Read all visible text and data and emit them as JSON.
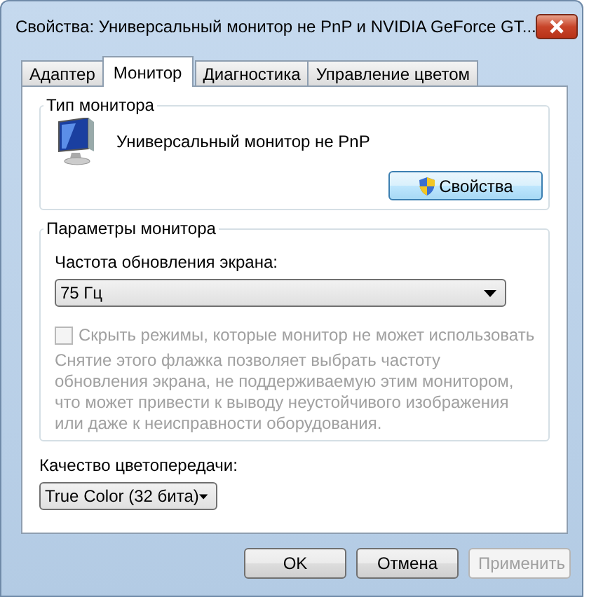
{
  "window": {
    "title": "Свойства: Универсальный монитор не PnP и NVIDIA GeForce GT..."
  },
  "tabs": [
    {
      "label": "Адаптер",
      "selected": false
    },
    {
      "label": "Монитор",
      "selected": true
    },
    {
      "label": "Диагностика",
      "selected": false
    },
    {
      "label": "Управление цветом",
      "selected": false
    }
  ],
  "monitor_type": {
    "title": "Тип монитора",
    "name": "Универсальный монитор не PnP",
    "button": "Свойства"
  },
  "monitor_settings": {
    "title": "Параметры монитора",
    "refresh_label": "Частота обновления экрана:",
    "refresh_value": "75 Гц",
    "hide_modes": {
      "label": "Скрыть режимы, которые монитор не может использовать",
      "checked": false,
      "disabled": true
    },
    "note": "Снятие этого флажка позволяет выбрать частоту обновления экрана, не поддерживаемую этим монитором, что может привести к выводу неустойчивого изображения или даже к неисправности оборудования."
  },
  "color": {
    "label": "Качество цветопередачи:",
    "value": "True Color (32 бита)"
  },
  "buttons": [
    {
      "label": "OK",
      "disabled": false
    },
    {
      "label": "Отмена",
      "disabled": false
    },
    {
      "label": "Применить",
      "disabled": true
    }
  ]
}
